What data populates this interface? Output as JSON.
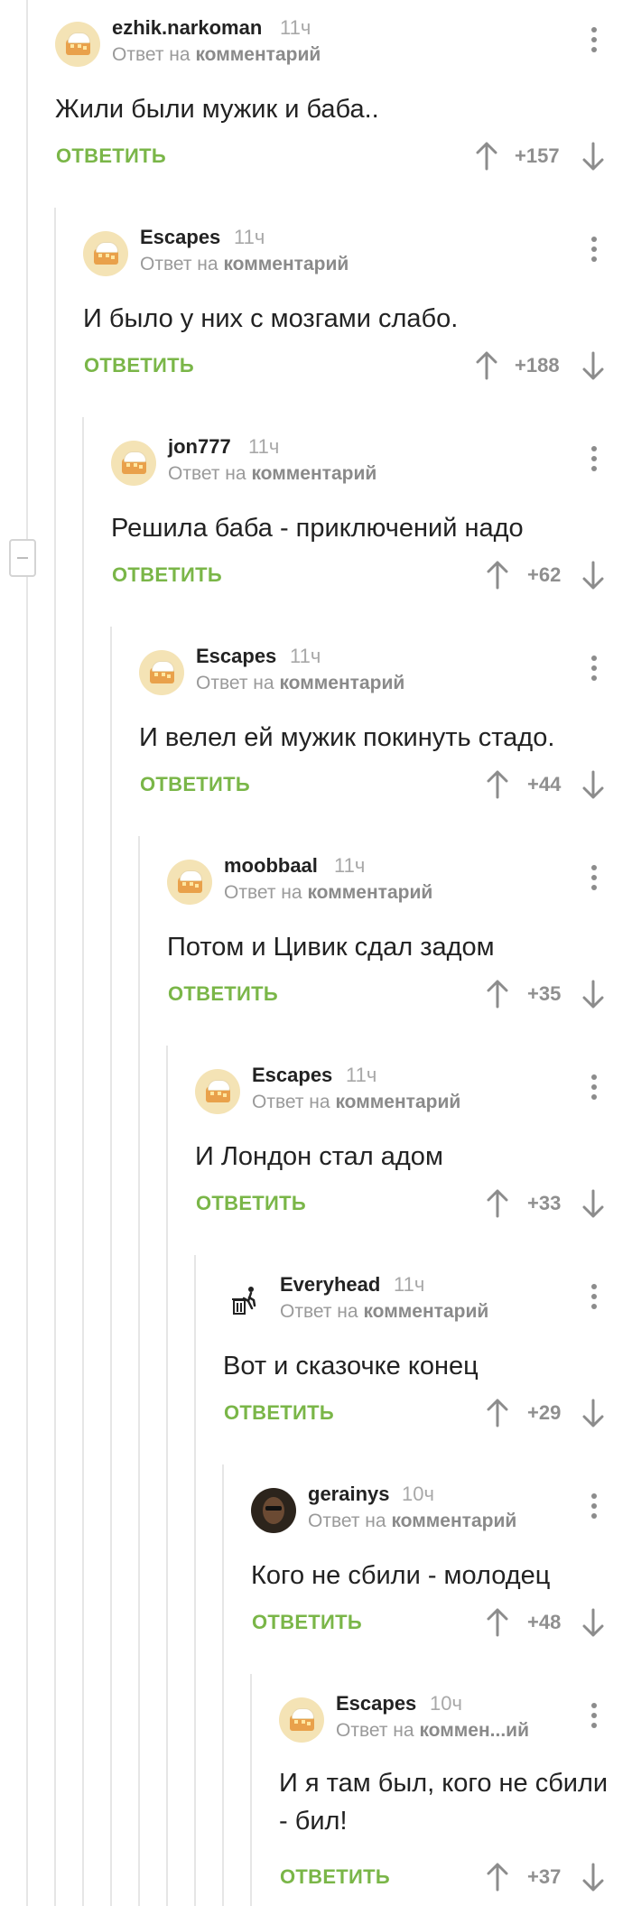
{
  "reply_label_suffix": "комментарий",
  "comments": [
    {
      "username": "ezhik.narkoman",
      "time": "11ч",
      "reply_prefix": "Ответ на",
      "reply_target": "комментарий",
      "text": "Жили были мужик и баба..",
      "reply_button": "ОТВЕТИТЬ",
      "rating": "+157"
    },
    {
      "username": "Escapes",
      "time": "11ч",
      "reply_prefix": "Ответ на",
      "reply_target": "комментарий",
      "text": "И было у них с мозгами слабо.",
      "reply_button": "ОТВЕТИТЬ",
      "rating": "+188"
    },
    {
      "username": "jon777",
      "time": "11ч",
      "reply_prefix": "Ответ на",
      "reply_target": "комментарий",
      "text": "Решила баба - приключений надо",
      "reply_button": "ОТВЕТИТЬ",
      "rating": "+62"
    },
    {
      "username": "Escapes",
      "time": "11ч",
      "reply_prefix": "Ответ на",
      "reply_target": "комментарий",
      "text": "И велел ей мужик покинуть стадо.",
      "reply_button": "ОТВЕТИТЬ",
      "rating": "+44"
    },
    {
      "username": "moobbaal",
      "time": "11ч",
      "reply_prefix": "Ответ на",
      "reply_target": "комментарий",
      "text": "Потом и Цивик сдал задом",
      "reply_button": "ОТВЕТИТЬ",
      "rating": "+35"
    },
    {
      "username": "Escapes",
      "time": "11ч",
      "reply_prefix": "Ответ на",
      "reply_target": "комментарий",
      "text": "И Лондон стал адом",
      "reply_button": "ОТВЕТИТЬ",
      "rating": "+33"
    },
    {
      "username": "Everyhead",
      "time": "11ч",
      "reply_prefix": "Ответ на",
      "reply_target": "комментарий",
      "text": "Вот и сказочке конец",
      "reply_button": "ОТВЕТИТЬ",
      "rating": "+29"
    },
    {
      "username": "gerainys",
      "time": "10ч",
      "reply_prefix": "Ответ на",
      "reply_target": "комментарий",
      "text": "Кого не сбили - молодец",
      "reply_button": "ОТВЕТИТЬ",
      "rating": "+48"
    },
    {
      "username": "Escapes",
      "time": "10ч",
      "reply_prefix": "Ответ на",
      "reply_target": "коммен...ий",
      "text": "И я там был, кого не сбили - бил!",
      "reply_button": "ОТВЕТИТЬ",
      "rating": "+37"
    }
  ],
  "icons": {
    "avatar_default": "pie-avatar-icon",
    "avatar_everyhead": "trash-bin-figure-icon",
    "avatar_gerainys": "person-photo-avatar",
    "upvote": "arrow-up-icon",
    "downvote": "arrow-down-icon",
    "menu": "more-vertical-icon",
    "collapse": "collapse-thread-icon"
  },
  "colors": {
    "reply_green": "#7ab648",
    "rating_gray": "#8f8f8f",
    "thread_line": "#e6e6e6"
  }
}
